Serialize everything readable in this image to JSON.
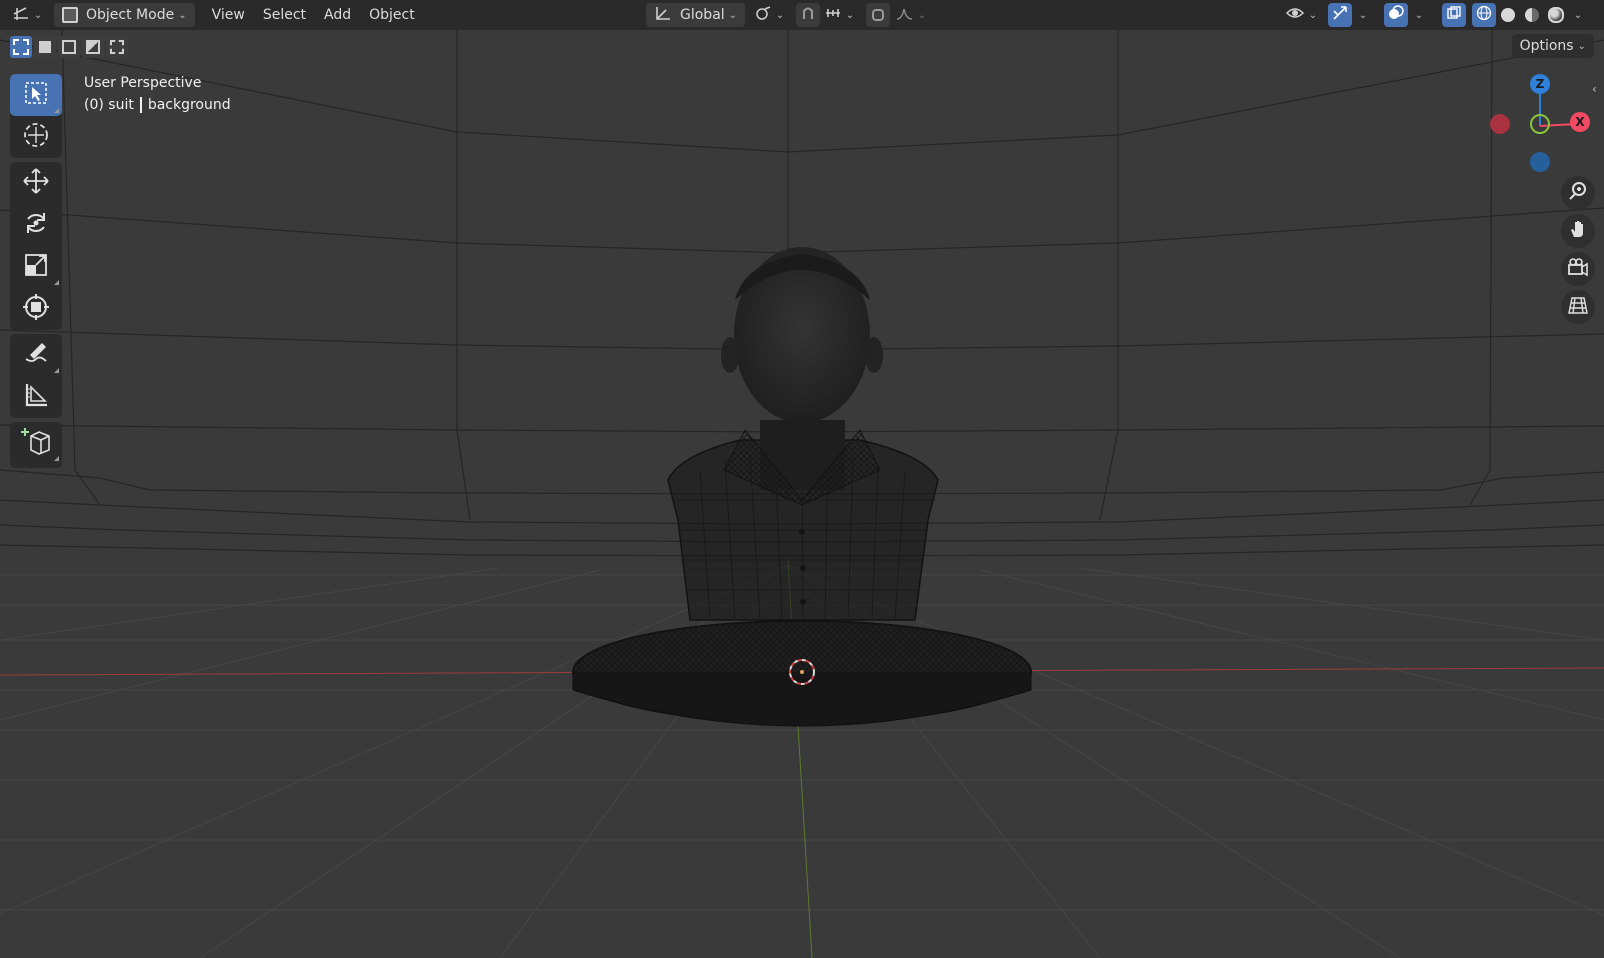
{
  "header": {
    "editor_type_icon": "axis-grid-icon",
    "mode_label": "Object Mode",
    "menus": [
      "View",
      "Select",
      "Add",
      "Object"
    ],
    "transform_orientation": "Global",
    "icons": [
      "transform-pivot-icon",
      "snap-icon",
      "snap-increment-icon",
      "proportional-edit-icon",
      "falloff-curve-icon",
      "visibility-icon",
      "gizmo-icon",
      "overlay-icon",
      "xray-icon",
      "wireframe-shading-icon",
      "solid-shading-icon",
      "material-preview-icon",
      "rendered-shading-icon"
    ]
  },
  "select_modes": [
    "select-new-icon",
    "select-extend-icon",
    "select-subtract-icon",
    "select-invert-icon",
    "select-intersect-icon"
  ],
  "options_label": "Options",
  "viewport": {
    "view_name": "User Perspective",
    "frame_collection": "(0) suit",
    "active_object": "background"
  },
  "toolbar": {
    "tools": [
      "select-box-icon",
      "cursor-icon",
      "move-icon",
      "rotate-icon",
      "scale-icon",
      "transform-icon",
      "annotate-icon",
      "measure-icon",
      "add-cube-icon"
    ]
  },
  "gizmo": {
    "axes": [
      "Z",
      "X"
    ],
    "colors": {
      "x": "#f24a63",
      "y": "#8ac43a",
      "z": "#2f80d8",
      "neg_x": "#a8323f",
      "neg_z": "#255f9c"
    }
  },
  "nav_buttons": [
    "zoom-icon",
    "hand-pan-icon",
    "camera-view-icon",
    "ortho-grid-icon"
  ],
  "colors": {
    "accent": "#4772b3",
    "header_bg": "#2a2a2a",
    "viewport_bg": "#3a3a3a",
    "x_axis_line": "#9e3a3a"
  }
}
